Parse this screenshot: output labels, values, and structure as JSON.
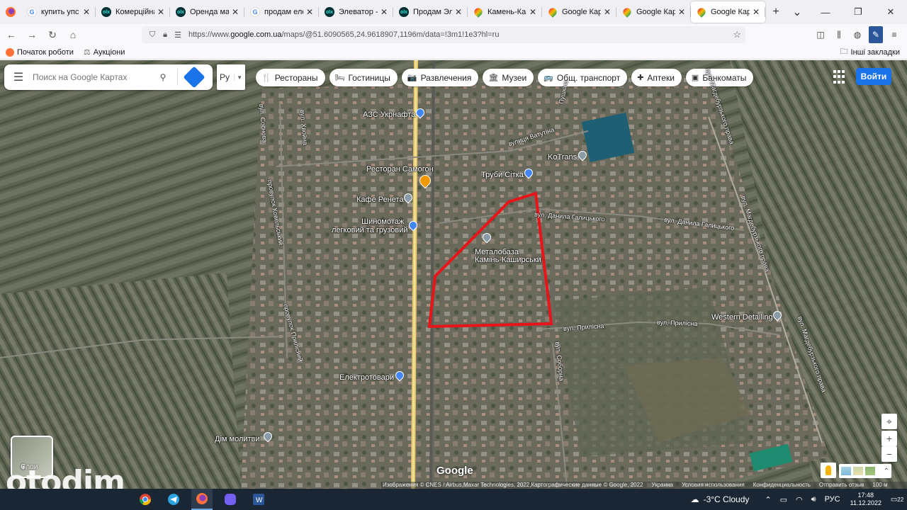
{
  "browser": {
    "tabs": [
      {
        "title": "купить упс - П",
        "icon": "google-icon",
        "color": "#ffffff",
        "glyph": "G"
      },
      {
        "title": "Комерційна не",
        "icon": "olx-icon",
        "color": "#23e5db",
        "glyph": "olx"
      },
      {
        "title": "Оренда магази",
        "icon": "olx-icon",
        "color": "#23e5db",
        "glyph": "olx"
      },
      {
        "title": "продам елеват",
        "icon": "google-icon",
        "color": "#ffffff",
        "glyph": "G"
      },
      {
        "title": "Элеватор - Нер",
        "icon": "olx-icon",
        "color": "#23e5db",
        "glyph": "olx"
      },
      {
        "title": "Продам Элева",
        "icon": "olx-icon",
        "color": "#23e5db",
        "glyph": "olx"
      },
      {
        "title": "Камень-Кашир",
        "icon": "maps-pin-icon",
        "color": "#34a853",
        "glyph": ""
      },
      {
        "title": "Google Карты",
        "icon": "maps-pin-icon",
        "color": "#34a853",
        "glyph": ""
      },
      {
        "title": "Google Карты",
        "icon": "maps-pin-icon",
        "color": "#34a853",
        "glyph": ""
      },
      {
        "title": "Google Карты",
        "icon": "maps-pin-icon",
        "color": "#34a853",
        "glyph": "",
        "active": true
      }
    ],
    "url_prefix": "https://www.",
    "url_domain": "google.com.ua",
    "url_rest": "/maps/@51.6090565,24.9618907,1196m/data=!3m1!1e3?hl=ru",
    "bookmarks": [
      {
        "label": "Початок роботи",
        "icon": "firefox-icon"
      },
      {
        "label": "Аукціони",
        "icon": "auction-icon"
      }
    ],
    "other_bookmarks": "Інші закладки"
  },
  "map": {
    "search_placeholder": "Поиск на Google Картах",
    "lang": "Ру",
    "chips": [
      {
        "label": "Рестораны",
        "icon": "fork-knife-icon",
        "glyph": "🍴"
      },
      {
        "label": "Гостиницы",
        "icon": "bed-icon",
        "glyph": "🛏"
      },
      {
        "label": "Развлечения",
        "icon": "camera-icon",
        "glyph": "📷"
      },
      {
        "label": "Музеи",
        "icon": "museum-icon",
        "glyph": "🏛"
      },
      {
        "label": "Общ. транспорт",
        "icon": "bus-icon",
        "glyph": "🚌"
      },
      {
        "label": "Аптеки",
        "icon": "pharmacy-icon",
        "glyph": "✚"
      },
      {
        "label": "Банкоматы",
        "icon": "atm-icon",
        "glyph": "▣"
      }
    ],
    "login": "Войти",
    "places": {
      "azs": "АЗС Укрнафта",
      "restoran": "Ресторан Самогон",
      "kafe": "Кафе Ренета",
      "shino1": "Шиномотаж",
      "shino2": "легковий та грузовий",
      "kotrans": "KoTrans",
      "truby": "Труби Сітка",
      "metal1": "Металобаза",
      "metal2": "Камінь-Каширськи",
      "western": "Western Detailing",
      "elektro": "Електротовари",
      "dim": "Дім молитви"
    },
    "streets": {
      "vatutina": "вулиця Ватутіна",
      "pushkina": "Пушкіна",
      "halytskoho1": "вул. Данила Галицького",
      "halytskoho2": "вул. Данила Галицького",
      "pryli1": "вул. Прилісна",
      "pryli2": "вул. Прилісна",
      "sosnova": "вул. Соснова",
      "khvoina": "вул. Хвойна",
      "kovelskyi": "провулок Ковельський",
      "pryliskyi": "провулок Прилісний",
      "soborna": "вул. Соборна",
      "magd1": "вул. Магдебурзького права",
      "magd2": "вул. Магдебурзького права",
      "magd3": "вул. Магдебурзького права"
    },
    "layers_label": "Слои",
    "logo": "Google",
    "attribution": [
      "Изображения © CNES / Airbus,Maxar Technologies, 2022,Картографические данные © Google, 2022",
      "Украина",
      "Условия использования",
      "Конфиденциальность",
      "Отправить отзыв",
      "100 м"
    ],
    "highlight_color": "#e8141a"
  },
  "watermark": "otodim",
  "taskbar": {
    "weather": "-3°C  Cloudy",
    "lang": "РУС",
    "time": "17:48",
    "date": "11.12.2022",
    "notifications": "22"
  }
}
